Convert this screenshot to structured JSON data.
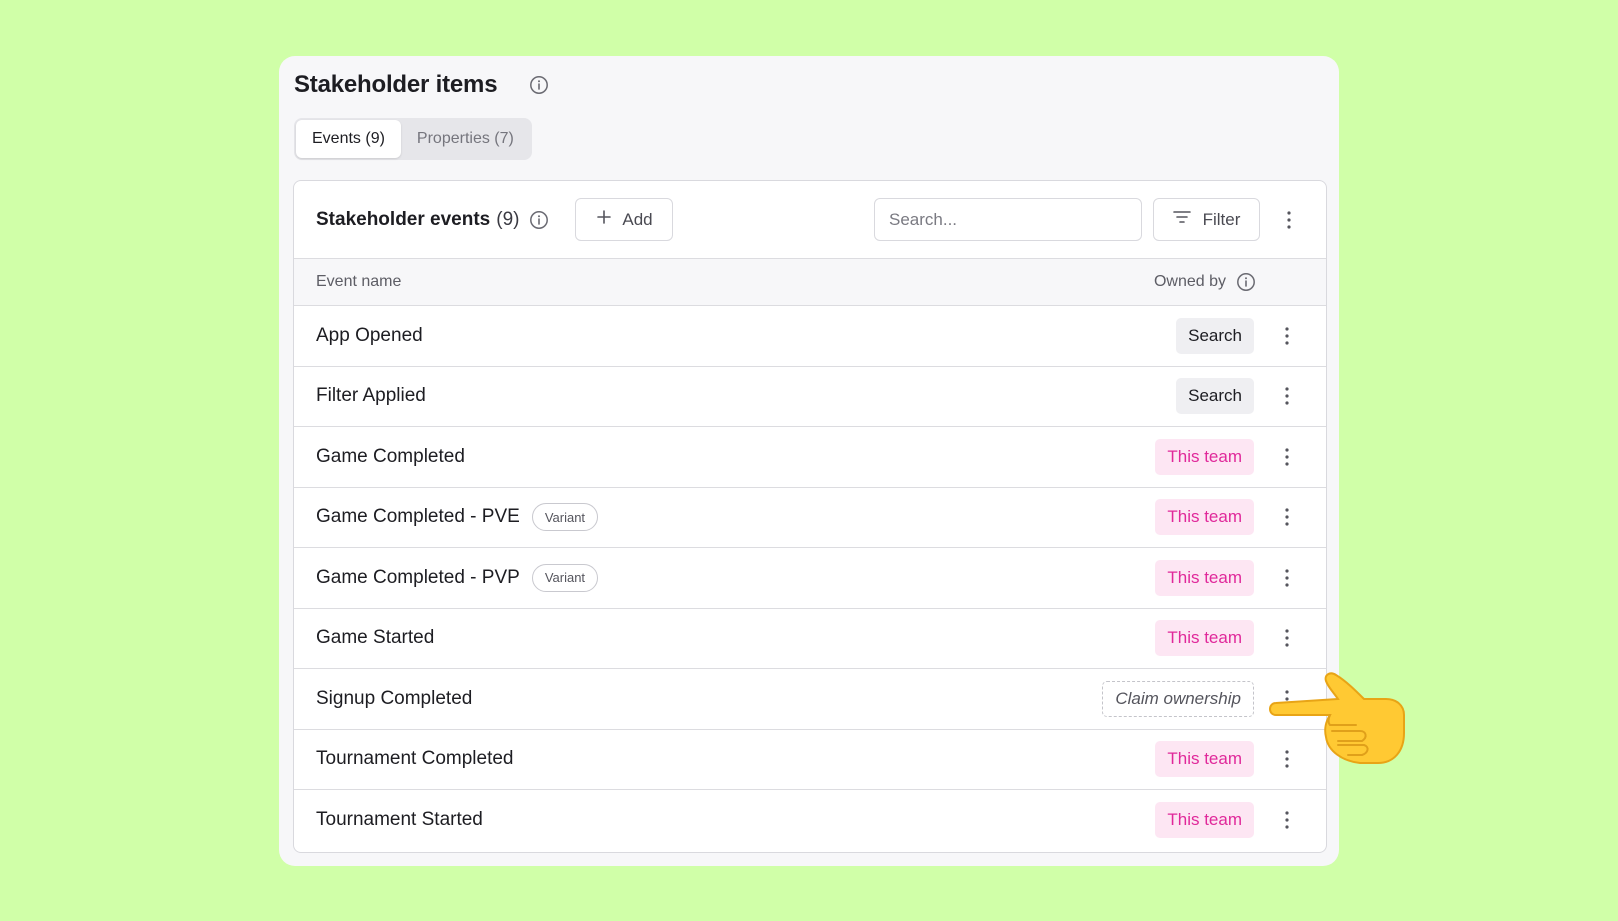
{
  "card": {
    "title": "Stakeholder items"
  },
  "tabs": [
    {
      "label": "Events (9)",
      "active": true
    },
    {
      "label": "Properties (7)",
      "active": false
    }
  ],
  "toolbar": {
    "title": "Stakeholder events",
    "count": "(9)",
    "add_label": "Add",
    "search_placeholder": "Search...",
    "filter_label": "Filter"
  },
  "columns": {
    "event_name": "Event name",
    "owned_by": "Owned by"
  },
  "rows": [
    {
      "name": "App Opened",
      "variant": null,
      "owner": "Search",
      "owner_type": "search"
    },
    {
      "name": "Filter Applied",
      "variant": null,
      "owner": "Search",
      "owner_type": "search"
    },
    {
      "name": "Game Completed",
      "variant": null,
      "owner": "This team",
      "owner_type": "team"
    },
    {
      "name": "Game Completed - PVE",
      "variant": "Variant",
      "owner": "This team",
      "owner_type": "team"
    },
    {
      "name": "Game Completed - PVP",
      "variant": "Variant",
      "owner": "This team",
      "owner_type": "team"
    },
    {
      "name": "Game Started",
      "variant": null,
      "owner": "This team",
      "owner_type": "team"
    },
    {
      "name": "Signup Completed",
      "variant": null,
      "owner": "Claim ownership",
      "owner_type": "claim"
    },
    {
      "name": "Tournament Completed",
      "variant": null,
      "owner": "This team",
      "owner_type": "team"
    },
    {
      "name": "Tournament Started",
      "variant": null,
      "owner": "This team",
      "owner_type": "team"
    }
  ],
  "colors": {
    "background": "#d0ffa8",
    "team_badge_bg": "#fde6f3",
    "team_badge_text": "#e0289a",
    "search_badge_bg": "#efeff2"
  },
  "icons": {
    "info": "info-icon",
    "add": "plus-icon",
    "filter": "filter-icon",
    "more": "kebab-icon",
    "pointer": "pointing-hand-icon"
  }
}
